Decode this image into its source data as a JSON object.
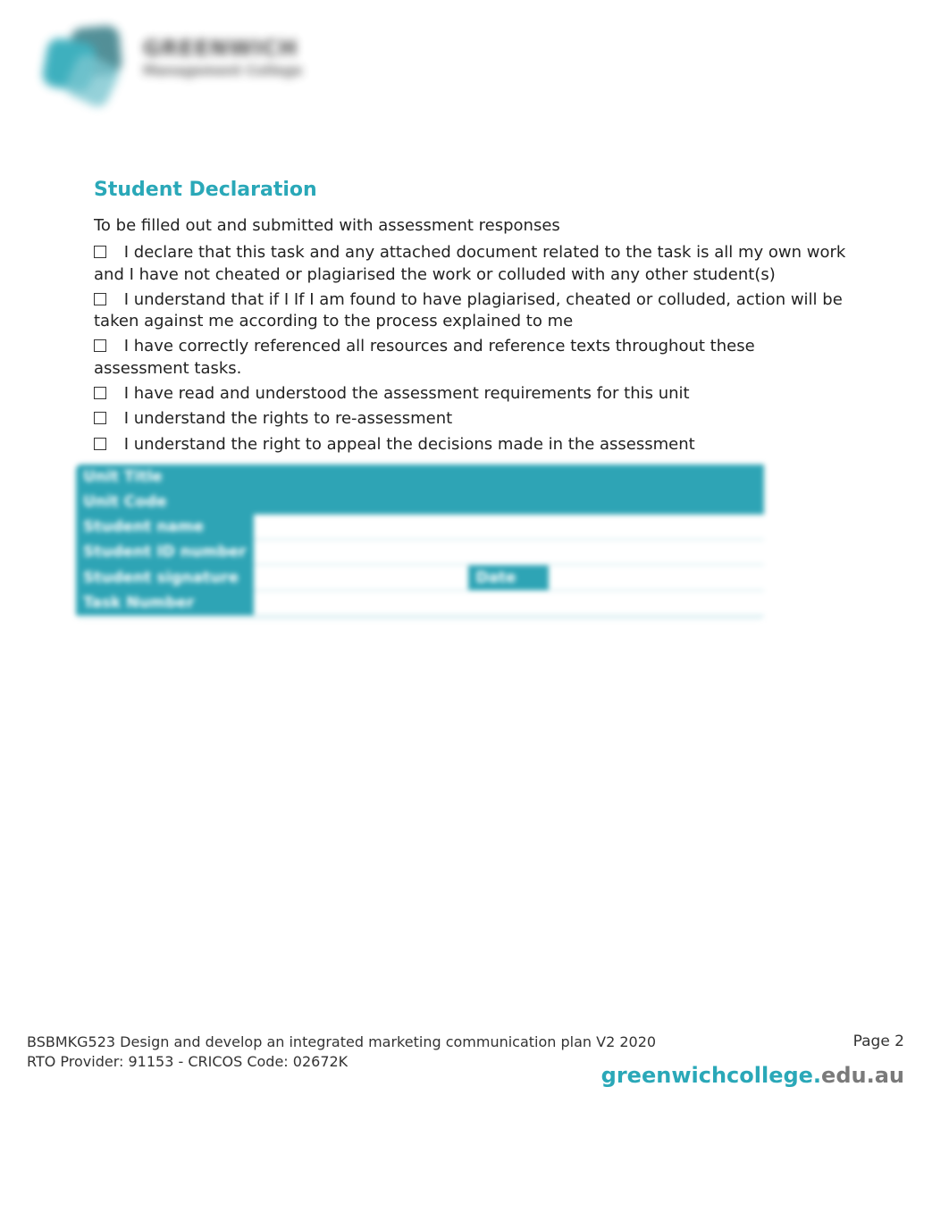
{
  "logo": {
    "line1": "GREENWICH",
    "line2": "Management College"
  },
  "heading": "Student Declaration",
  "intro": "To be filled out and submitted with assessment responses",
  "declarations": [
    "I declare that this task and any attached document related to the task is all my own work and I have not cheated or plagiarised the work or colluded with any other student(s)",
    "I understand that if I If I am found to have plagiarised, cheated or colluded, action will be taken against me according to the process explained to me",
    "I have correctly referenced all resources and reference texts throughout these assessment tasks.",
    "I have read and understood the assessment requirements for this unit",
    "I understand the rights to re-assessment",
    "I understand the right to appeal the decisions made in the assessment"
  ],
  "form": {
    "unit_title_label": "Unit Title",
    "unit_code_label": "Unit Code",
    "student_name_label": "Student name",
    "student_id_label": "Student ID number",
    "student_sig_label": "Student signature",
    "date_label": "Date",
    "task_number_label": "Task Number",
    "student_name_value": "",
    "student_id_value": "",
    "student_sig_value": "",
    "date_value": "",
    "task_number_value_a": "",
    "task_number_value_b": ""
  },
  "footer": {
    "course_line": "BSBMKG523 Design and develop an integrated marketing communication plan V2 2020",
    "provider_line": "RTO Provider: 91153  - CRICOS  Code: 02672K",
    "page_label": "Page 2",
    "site_bold": "greenwichcollege.",
    "site_rest": "edu.au"
  }
}
